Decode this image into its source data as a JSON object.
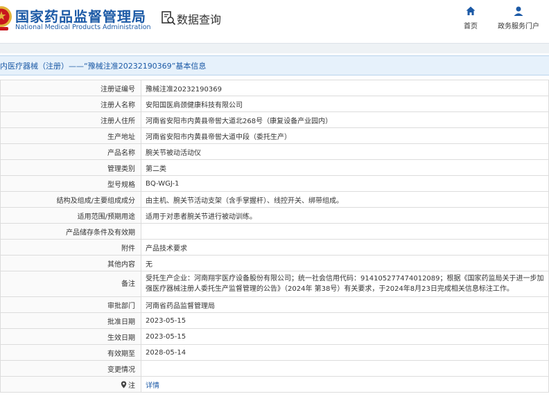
{
  "header": {
    "org_name_cn": "国家药品监督管理局",
    "org_name_en": "National Medical Products Administration",
    "page_title": "数据查询",
    "nav": {
      "home": "首页",
      "portal": "政务服务门户"
    }
  },
  "section": {
    "title": "内医疗器械（注册）——“豫械注准20232190369”基本信息"
  },
  "rows": [
    {
      "label": "注册证编号",
      "value": "豫械注准20232190369"
    },
    {
      "label": "注册人名称",
      "value": "安阳国医肩颈健康科技有限公司"
    },
    {
      "label": "注册人住所",
      "value": "河南省安阳市内黄县帝喾大道北268号（康复设备产业园内）"
    },
    {
      "label": "生产地址",
      "value": "河南省安阳市内黄县帝喾大道中段（委托生产）"
    },
    {
      "label": "产品名称",
      "value": "腕关节被动活动仪"
    },
    {
      "label": "管理类别",
      "value": "第二类"
    },
    {
      "label": "型号规格",
      "value": "BQ-WGJ-1"
    },
    {
      "label": "结构及组成/主要组成成分",
      "value": "由主机、腕关节活动支架（含手掌握杆）、线控开关、绑带组成。"
    },
    {
      "label": "适用范围/预期用途",
      "value": "适用于对患者腕关节进行被动训练。"
    },
    {
      "label": "产品储存条件及有效期",
      "value": ""
    },
    {
      "label": "附件",
      "value": "产品技术要求"
    },
    {
      "label": "其他内容",
      "value": "无"
    },
    {
      "label": "备注",
      "value": "受托生产企业：河南翔宇医疗设备股份有限公司；统一社会信用代码：914105277474012089；根据《国家药监局关于进一步加强医疗器械注册人委托生产监督管理的公告》（2024年 第38号）有关要求，于2024年8月23日完成相关信息标注工作。"
    },
    {
      "label": "审批部门",
      "value": "河南省药品监督管理局"
    },
    {
      "label": "批准日期",
      "value": "2023-05-15"
    },
    {
      "label": "生效日期",
      "value": "2023-05-15"
    },
    {
      "label": "有效期至",
      "value": "2028-05-14"
    },
    {
      "label": "变更情况",
      "value": ""
    }
  ],
  "note_row": {
    "label": "注",
    "link": "详情"
  },
  "colors": {
    "brand_blue": "#1c5aa6",
    "section_bg": "#e6f1fb",
    "emblem_red": "#c8161d",
    "emblem_gold": "#e2b23a"
  },
  "icons": {
    "emblem": "national-emblem-icon",
    "query": "data-query-icon",
    "home": "home-icon",
    "portal": "user-icon",
    "note": "location-pin-icon"
  }
}
